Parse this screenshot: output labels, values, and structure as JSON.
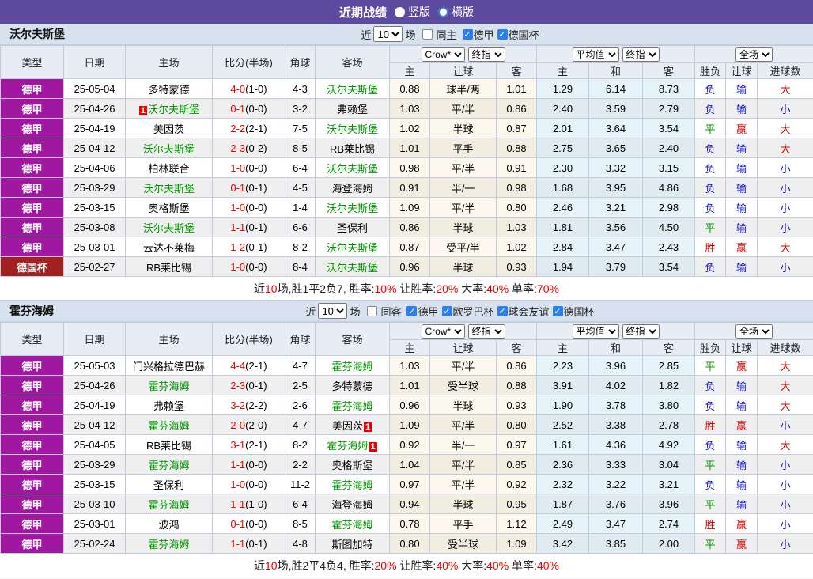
{
  "topbar": {
    "title": "近期战绩",
    "radio_vertical": "竖版",
    "radio_horizontal": "横版",
    "selected": "竖版"
  },
  "colors": {
    "topbar": "#5b4a9e",
    "league_badge": "#a018a0",
    "cup_badge": "#a32020",
    "focus_team": "#009900",
    "win": "#cc0000",
    "draw": "#009900",
    "loss": "#1414cc",
    "score": "#ee0000"
  },
  "columns": {
    "type": "类型",
    "date": "日期",
    "home": "主场",
    "score": "比分(半场)",
    "corner": "角球",
    "away": "客场",
    "h": "主",
    "hcp": "让球",
    "a": "客",
    "avg_h": "主",
    "avg_d": "和",
    "avg_a": "客",
    "wdl": "胜负",
    "hcp_res": "让球",
    "goals": "进球数"
  },
  "sections": [
    {
      "team": "沃尔夫斯堡",
      "near_label": "近",
      "games": "10",
      "games_suffix": "场",
      "same_label": "同主",
      "leagues": [
        "德甲",
        "德国杯"
      ],
      "dd": [
        "Crow*",
        "终指",
        "平均值",
        "终指",
        "全场"
      ],
      "rows": [
        {
          "type": "德甲",
          "cup": false,
          "date": "25-05-04",
          "home": "多特蒙德",
          "home_focus": false,
          "home_badge": "",
          "score": "4-0",
          "half": "(1-0)",
          "corner": "4-3",
          "away": "沃尔夫斯堡",
          "away_focus": true,
          "away_badge": "",
          "odds": [
            "0.88",
            "球半/两",
            "1.01"
          ],
          "avg": [
            "1.29",
            "6.14",
            "8.73"
          ],
          "res": [
            "负",
            "输",
            "大"
          ]
        },
        {
          "type": "德甲",
          "cup": false,
          "date": "25-04-26",
          "home": "沃尔夫斯堡",
          "home_focus": true,
          "home_badge": "1",
          "home_badge_pos": "before",
          "score": "0-1",
          "half": "(0-0)",
          "corner": "3-2",
          "away": "弗赖堡",
          "away_focus": false,
          "away_badge": "",
          "odds": [
            "1.03",
            "平/半",
            "0.86"
          ],
          "avg": [
            "2.40",
            "3.59",
            "2.79"
          ],
          "res": [
            "负",
            "输",
            "小"
          ]
        },
        {
          "type": "德甲",
          "cup": false,
          "date": "25-04-19",
          "home": "美因茨",
          "home_focus": false,
          "home_badge": "",
          "score": "2-2",
          "half": "(2-1)",
          "corner": "7-5",
          "away": "沃尔夫斯堡",
          "away_focus": true,
          "away_badge": "",
          "odds": [
            "1.02",
            "半球",
            "0.87"
          ],
          "avg": [
            "2.01",
            "3.64",
            "3.54"
          ],
          "res": [
            "平",
            "赢",
            "大"
          ]
        },
        {
          "type": "德甲",
          "cup": false,
          "date": "25-04-12",
          "home": "沃尔夫斯堡",
          "home_focus": true,
          "home_badge": "",
          "score": "2-3",
          "half": "(0-2)",
          "corner": "8-5",
          "away": "RB莱比锡",
          "away_focus": false,
          "away_badge": "",
          "odds": [
            "1.01",
            "平手",
            "0.88"
          ],
          "avg": [
            "2.75",
            "3.65",
            "2.40"
          ],
          "res": [
            "负",
            "输",
            "大"
          ]
        },
        {
          "type": "德甲",
          "cup": false,
          "date": "25-04-06",
          "home": "柏林联合",
          "home_focus": false,
          "home_badge": "",
          "score": "1-0",
          "half": "(0-0)",
          "corner": "6-4",
          "away": "沃尔夫斯堡",
          "away_focus": true,
          "away_badge": "",
          "odds": [
            "0.98",
            "平/半",
            "0.91"
          ],
          "avg": [
            "2.30",
            "3.32",
            "3.15"
          ],
          "res": [
            "负",
            "输",
            "小"
          ]
        },
        {
          "type": "德甲",
          "cup": false,
          "date": "25-03-29",
          "home": "沃尔夫斯堡",
          "home_focus": true,
          "home_badge": "",
          "score": "0-1",
          "half": "(0-1)",
          "corner": "4-5",
          "away": "海登海姆",
          "away_focus": false,
          "away_badge": "",
          "odds": [
            "0.91",
            "半/一",
            "0.98"
          ],
          "avg": [
            "1.68",
            "3.95",
            "4.86"
          ],
          "res": [
            "负",
            "输",
            "小"
          ]
        },
        {
          "type": "德甲",
          "cup": false,
          "date": "25-03-15",
          "home": "奥格斯堡",
          "home_focus": false,
          "home_badge": "",
          "score": "1-0",
          "half": "(0-0)",
          "corner": "1-4",
          "away": "沃尔夫斯堡",
          "away_focus": true,
          "away_badge": "",
          "odds": [
            "1.09",
            "平/半",
            "0.80"
          ],
          "avg": [
            "2.46",
            "3.21",
            "2.98"
          ],
          "res": [
            "负",
            "输",
            "小"
          ]
        },
        {
          "type": "德甲",
          "cup": false,
          "date": "25-03-08",
          "home": "沃尔夫斯堡",
          "home_focus": true,
          "home_badge": "",
          "score": "1-1",
          "half": "(0-1)",
          "corner": "6-6",
          "away": "圣保利",
          "away_focus": false,
          "away_badge": "",
          "odds": [
            "0.86",
            "半球",
            "1.03"
          ],
          "avg": [
            "1.81",
            "3.56",
            "4.50"
          ],
          "res": [
            "平",
            "输",
            "小"
          ]
        },
        {
          "type": "德甲",
          "cup": false,
          "date": "25-03-01",
          "home": "云达不莱梅",
          "home_focus": false,
          "home_badge": "",
          "score": "1-2",
          "half": "(0-1)",
          "corner": "8-2",
          "away": "沃尔夫斯堡",
          "away_focus": true,
          "away_badge": "",
          "odds": [
            "0.87",
            "受平/半",
            "1.02"
          ],
          "avg": [
            "2.84",
            "3.47",
            "2.43"
          ],
          "res": [
            "胜",
            "赢",
            "大"
          ]
        },
        {
          "type": "德国杯",
          "cup": true,
          "date": "25-02-27",
          "home": "RB莱比锡",
          "home_focus": false,
          "home_badge": "",
          "score": "1-0",
          "half": "(0-0)",
          "corner": "8-4",
          "away": "沃尔夫斯堡",
          "away_focus": true,
          "away_badge": "",
          "odds": [
            "0.96",
            "半球",
            "0.93"
          ],
          "avg": [
            "1.94",
            "3.79",
            "3.54"
          ],
          "res": [
            "负",
            "输",
            "小"
          ]
        }
      ],
      "summary": [
        {
          "t": "近",
          "c": "k"
        },
        {
          "t": "10",
          "c": "r"
        },
        {
          "t": "场,胜1平2负7, 胜率:",
          "c": "k"
        },
        {
          "t": "10%",
          "c": "r"
        },
        {
          "t": " 让胜率:",
          "c": "k"
        },
        {
          "t": "20%",
          "c": "r"
        },
        {
          "t": " 大率:",
          "c": "k"
        },
        {
          "t": "40%",
          "c": "r"
        },
        {
          "t": " 单率:",
          "c": "k"
        },
        {
          "t": "70%",
          "c": "r"
        }
      ]
    },
    {
      "team": "霍芬海姆",
      "near_label": "近",
      "games": "10",
      "games_suffix": "场",
      "same_label": "同客",
      "leagues": [
        "德甲",
        "欧罗巴杯",
        "球会友谊",
        "德国杯"
      ],
      "dd": [
        "Crow*",
        "终指",
        "平均值",
        "终指",
        "全场"
      ],
      "rows": [
        {
          "type": "德甲",
          "cup": false,
          "date": "25-05-03",
          "home": "门兴格拉德巴赫",
          "home_focus": false,
          "home_badge": "",
          "score": "4-4",
          "half": "(2-1)",
          "corner": "4-7",
          "away": "霍芬海姆",
          "away_focus": true,
          "away_badge": "",
          "odds": [
            "1.03",
            "平/半",
            "0.86"
          ],
          "avg": [
            "2.23",
            "3.96",
            "2.85"
          ],
          "res": [
            "平",
            "赢",
            "大"
          ]
        },
        {
          "type": "德甲",
          "cup": false,
          "date": "25-04-26",
          "home": "霍芬海姆",
          "home_focus": true,
          "home_badge": "",
          "score": "2-3",
          "half": "(0-1)",
          "corner": "2-5",
          "away": "多特蒙德",
          "away_focus": false,
          "away_badge": "",
          "odds": [
            "1.01",
            "受半球",
            "0.88"
          ],
          "avg": [
            "3.91",
            "4.02",
            "1.82"
          ],
          "res": [
            "负",
            "输",
            "大"
          ]
        },
        {
          "type": "德甲",
          "cup": false,
          "date": "25-04-19",
          "home": "弗赖堡",
          "home_focus": false,
          "home_badge": "",
          "score": "3-2",
          "half": "(2-2)",
          "corner": "2-6",
          "away": "霍芬海姆",
          "away_focus": true,
          "away_badge": "",
          "odds": [
            "0.96",
            "半球",
            "0.93"
          ],
          "avg": [
            "1.90",
            "3.78",
            "3.80"
          ],
          "res": [
            "负",
            "输",
            "大"
          ]
        },
        {
          "type": "德甲",
          "cup": false,
          "date": "25-04-12",
          "home": "霍芬海姆",
          "home_focus": true,
          "home_badge": "",
          "score": "2-0",
          "half": "(2-0)",
          "corner": "4-7",
          "away": "美因茨",
          "away_focus": false,
          "away_badge": "1",
          "odds": [
            "1.09",
            "平/半",
            "0.80"
          ],
          "avg": [
            "2.52",
            "3.38",
            "2.78"
          ],
          "res": [
            "胜",
            "赢",
            "小"
          ]
        },
        {
          "type": "德甲",
          "cup": false,
          "date": "25-04-05",
          "home": "RB莱比锡",
          "home_focus": false,
          "home_badge": "",
          "score": "3-1",
          "half": "(2-1)",
          "corner": "8-2",
          "away": "霍芬海姆",
          "away_focus": true,
          "away_badge": "1",
          "odds": [
            "0.92",
            "半/一",
            "0.97"
          ],
          "avg": [
            "1.61",
            "4.36",
            "4.92"
          ],
          "res": [
            "负",
            "输",
            "大"
          ]
        },
        {
          "type": "德甲",
          "cup": false,
          "date": "25-03-29",
          "home": "霍芬海姆",
          "home_focus": true,
          "home_badge": "",
          "score": "1-1",
          "half": "(0-0)",
          "corner": "2-2",
          "away": "奥格斯堡",
          "away_focus": false,
          "away_badge": "",
          "odds": [
            "1.04",
            "平/半",
            "0.85"
          ],
          "avg": [
            "2.36",
            "3.33",
            "3.04"
          ],
          "res": [
            "平",
            "输",
            "小"
          ]
        },
        {
          "type": "德甲",
          "cup": false,
          "date": "25-03-15",
          "home": "圣保利",
          "home_focus": false,
          "home_badge": "",
          "score": "1-0",
          "half": "(0-0)",
          "corner": "11-2",
          "away": "霍芬海姆",
          "away_focus": true,
          "away_badge": "",
          "odds": [
            "0.97",
            "平/半",
            "0.92"
          ],
          "avg": [
            "2.32",
            "3.22",
            "3.21"
          ],
          "res": [
            "负",
            "输",
            "小"
          ]
        },
        {
          "type": "德甲",
          "cup": false,
          "date": "25-03-10",
          "home": "霍芬海姆",
          "home_focus": true,
          "home_badge": "",
          "score": "1-1",
          "half": "(1-0)",
          "corner": "6-4",
          "away": "海登海姆",
          "away_focus": false,
          "away_badge": "",
          "odds": [
            "0.94",
            "半球",
            "0.95"
          ],
          "avg": [
            "1.87",
            "3.76",
            "3.96"
          ],
          "res": [
            "平",
            "输",
            "小"
          ]
        },
        {
          "type": "德甲",
          "cup": false,
          "date": "25-03-01",
          "home": "波鸿",
          "home_focus": false,
          "home_badge": "",
          "score": "0-1",
          "half": "(0-0)",
          "corner": "8-5",
          "away": "霍芬海姆",
          "away_focus": true,
          "away_badge": "",
          "odds": [
            "0.78",
            "平手",
            "1.12"
          ],
          "avg": [
            "2.49",
            "3.47",
            "2.74"
          ],
          "res": [
            "胜",
            "赢",
            "小"
          ]
        },
        {
          "type": "德甲",
          "cup": false,
          "date": "25-02-24",
          "home": "霍芬海姆",
          "home_focus": true,
          "home_badge": "",
          "score": "1-1",
          "half": "(0-1)",
          "corner": "4-8",
          "away": "斯图加特",
          "away_focus": false,
          "away_badge": "",
          "odds": [
            "0.80",
            "受半球",
            "1.09"
          ],
          "avg": [
            "3.42",
            "3.85",
            "2.00"
          ],
          "res": [
            "平",
            "赢",
            "小"
          ]
        }
      ],
      "summary": [
        {
          "t": "近",
          "c": "k"
        },
        {
          "t": "10",
          "c": "r"
        },
        {
          "t": "场,胜2平4负4, 胜率:",
          "c": "k"
        },
        {
          "t": "20%",
          "c": "r"
        },
        {
          "t": " 让胜率:",
          "c": "k"
        },
        {
          "t": "40%",
          "c": "r"
        },
        {
          "t": " 大率:",
          "c": "k"
        },
        {
          "t": "40%",
          "c": "r"
        },
        {
          "t": " 单率:",
          "c": "k"
        },
        {
          "t": "40%",
          "c": "r"
        }
      ]
    }
  ]
}
